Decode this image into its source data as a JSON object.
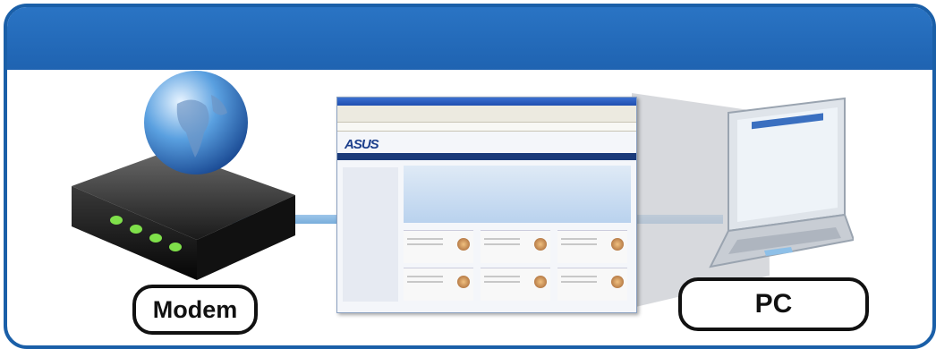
{
  "labels": {
    "modem": "Modem",
    "pc": "PC"
  },
  "icons": [
    "globe-icon",
    "modem-icon",
    "laptop-icon"
  ],
  "colors": {
    "frame": "#1a5fa8",
    "header": "#2368b8",
    "cable": "#8dbde6",
    "modem_led": "#7fe04a"
  }
}
